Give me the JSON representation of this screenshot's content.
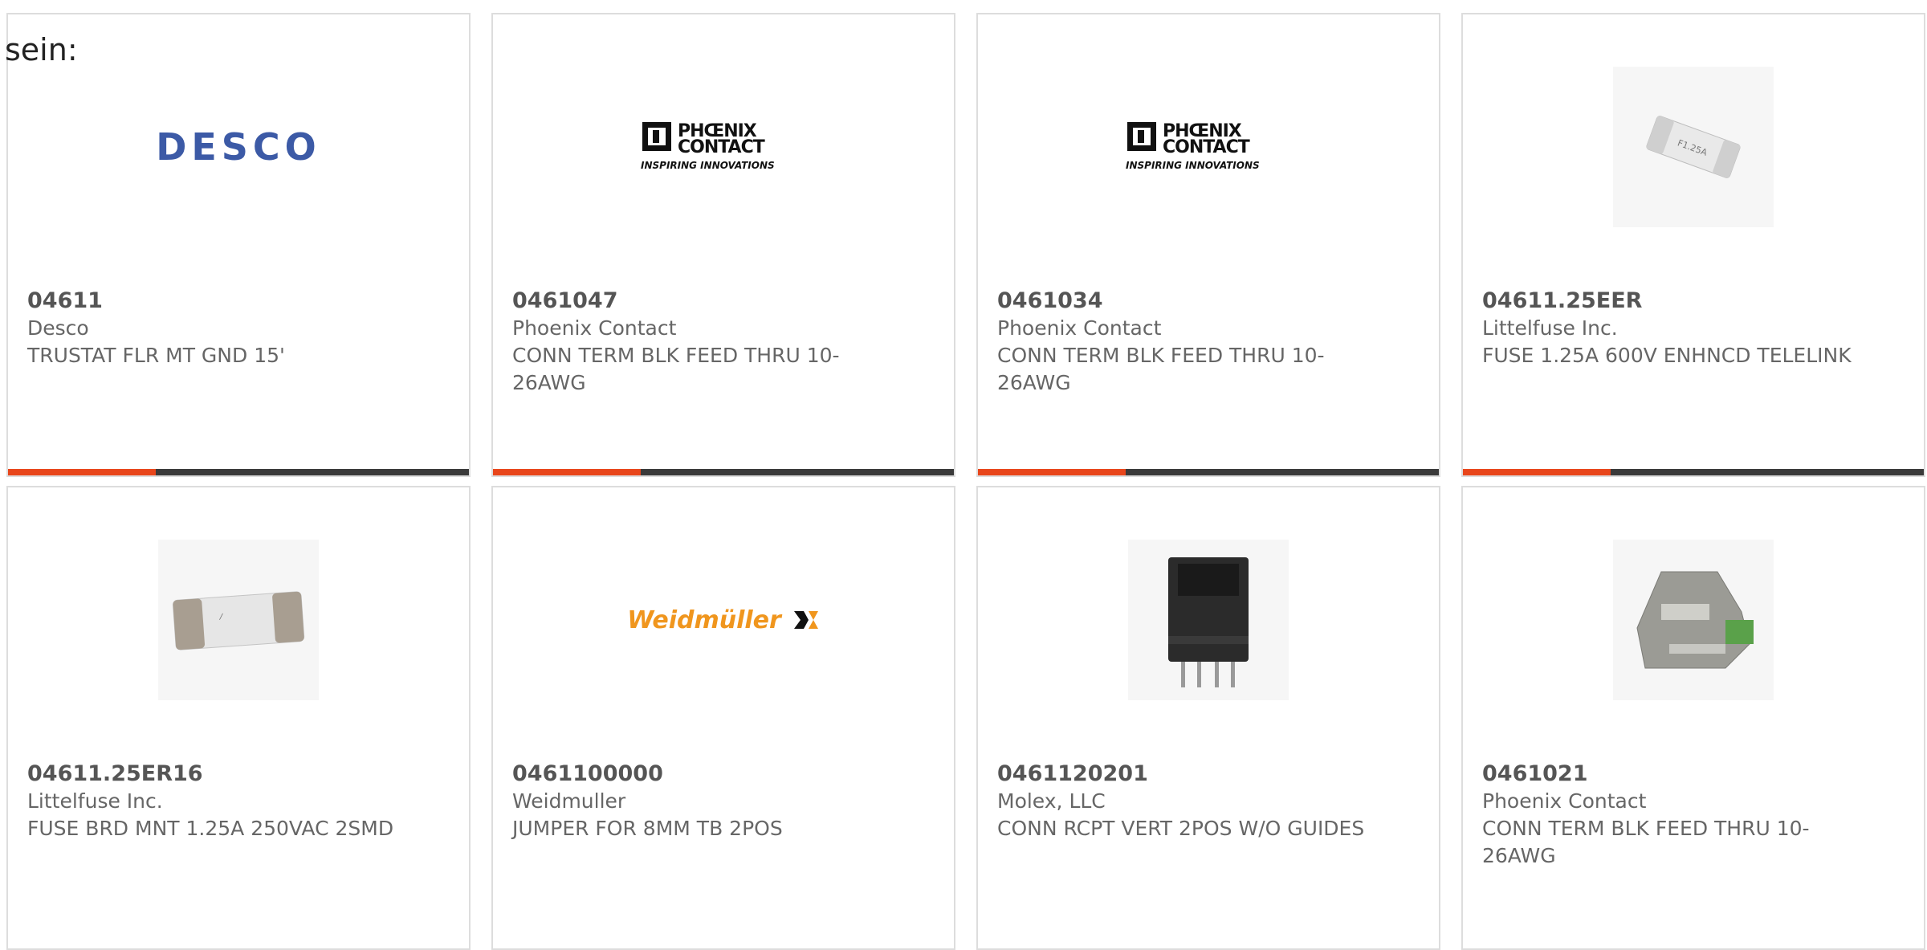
{
  "intro": {
    "text": "sein:"
  },
  "colors": {
    "accent": "#e8461b",
    "bar_track": "#3a3a3a",
    "border": "#dddddd",
    "text": "#666666"
  },
  "products": [
    {
      "part_number": "04611",
      "manufacturer": "Desco",
      "description": "TRUSTAT FLR MT GND 15'",
      "image": "desco-logo",
      "logo_text": "DESCO",
      "progress": 0.32
    },
    {
      "part_number": "0461047",
      "manufacturer": "Phoenix Contact",
      "description": "CONN TERM BLK FEED THRU 10-26AWG",
      "image": "phoenix-contact-logo",
      "logo_text": "PHŒNIX CONTACT",
      "logo_tagline": "INSPIRING INNOVATIONS",
      "progress": 0.32
    },
    {
      "part_number": "0461034",
      "manufacturer": "Phoenix Contact",
      "description": "CONN TERM BLK FEED THRU 10-26AWG",
      "image": "phoenix-contact-logo",
      "logo_text": "PHŒNIX CONTACT",
      "logo_tagline": "INSPIRING INNOVATIONS",
      "progress": 0.32
    },
    {
      "part_number": "04611.25EER",
      "manufacturer": "Littelfuse Inc.",
      "description": "FUSE 1.25A 600V ENHNCD TELELINK",
      "image": "fuse-photo",
      "progress": 0.32
    },
    {
      "part_number": "04611.25ER16",
      "manufacturer": "Littelfuse Inc.",
      "description": "FUSE BRD MNT 1.25A 250VAC 2SMD",
      "image": "fuse-photo"
    },
    {
      "part_number": "0461100000",
      "manufacturer": "Weidmuller",
      "description": "JUMPER FOR 8MM TB 2POS",
      "image": "weidmuller-logo",
      "logo_text": "Weidmüller"
    },
    {
      "part_number": "0461120201",
      "manufacturer": "Molex, LLC",
      "description": "CONN RCPT VERT 2POS W/O GUIDES",
      "image": "connector-photo"
    },
    {
      "part_number": "0461021",
      "manufacturer": "Phoenix Contact",
      "description": "CONN TERM BLK FEED THRU 10-26AWG",
      "image": "terminal-block-photo"
    }
  ]
}
